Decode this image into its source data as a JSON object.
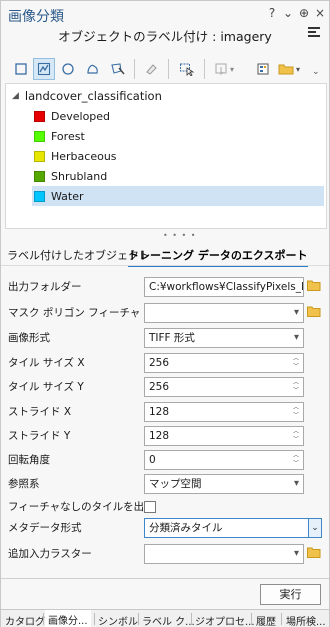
{
  "header": {
    "title": "画像分類",
    "subtitle": "オブジェクトのラベル付け : imagery",
    "controls": [
      "?",
      "⌄",
      "⊕",
      "×"
    ]
  },
  "toolbar": {
    "tools": [
      "rectangle-icon",
      "polygon-icon",
      "circle-icon",
      "freehand-icon",
      "auto-detect-icon",
      "eraser-icon",
      "select-icon",
      "collect-icon",
      "new-template-icon",
      "folder-icon",
      "save-icon"
    ]
  },
  "tree": {
    "root": "landcover_classification",
    "classes": [
      {
        "name": "Developed",
        "color": "#e60000"
      },
      {
        "name": "Forest",
        "color": "#55ff00"
      },
      {
        "name": "Herbaceous",
        "color": "#e6e600"
      },
      {
        "name": "Shrubland",
        "color": "#55a800"
      },
      {
        "name": "Water",
        "color": "#00c5ff"
      }
    ],
    "selected": "Water"
  },
  "tabs": {
    "labeled_objects": "ラベル付けしたオブジェクト",
    "export": "トレーニング データのエクスポート"
  },
  "form": {
    "output_folder": {
      "label": "出力フォルダー",
      "value": "C:¥workflows¥ClassifyPixels_lancc"
    },
    "mask_polygon": {
      "label": "マスク ポリゴン フィーチャ",
      "value": ""
    },
    "image_format": {
      "label": "画像形式",
      "value": "TIFF 形式"
    },
    "tile_size_x": {
      "label": "タイル サイズ X",
      "value": "256"
    },
    "tile_size_y": {
      "label": "タイル サイズ Y",
      "value": "256"
    },
    "stride_x": {
      "label": "ストライド X",
      "value": "128"
    },
    "stride_y": {
      "label": "ストライド Y",
      "value": "128"
    },
    "rotation": {
      "label": "回転角度",
      "value": "0"
    },
    "reference_system": {
      "label": "参照系",
      "value": "マップ空間"
    },
    "output_no_feature": {
      "label": "フィーチャなしのタイルを出力",
      "checked": false
    },
    "metadata_format": {
      "label": "メタデータ形式",
      "value": "分類済みタイル"
    },
    "additional_raster": {
      "label": "追加入力ラスター",
      "value": ""
    }
  },
  "run_label": "実行",
  "bottom_tabs": [
    "カタログ",
    "画像分...",
    "シンボル",
    "ラベル ク...",
    "ジオプロセ...",
    "履歴",
    "場所検..."
  ],
  "active_bottom_tab": "画像分..."
}
